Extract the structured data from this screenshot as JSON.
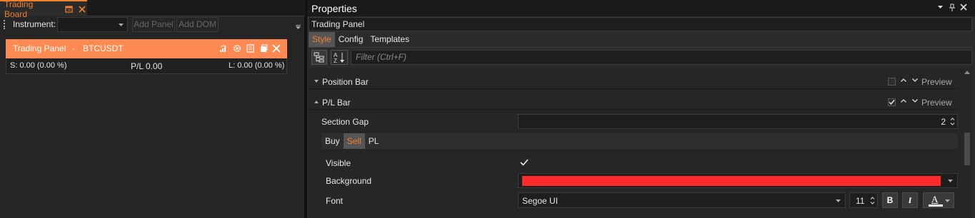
{
  "left_panel": {
    "tab_title": "Trading Board",
    "toolbar": {
      "instrument_label": "Instrument:",
      "instrument_value": "",
      "add_panel_label": "Add Panel",
      "add_dom_label": "Add DOM"
    },
    "trading_panel": {
      "title": "Trading Panel",
      "separator": "-",
      "symbol": "BTCUSDT",
      "short_label": "S:  0.00 (0.00 %)",
      "pl_label": "P/L  0.00",
      "long_label": "L:  0.00 (0.00 %)",
      "header_color": "#fd8a52"
    }
  },
  "properties": {
    "title": "Properties",
    "object_name": "Trading Panel",
    "tabs": [
      {
        "label": "Style",
        "active": true
      },
      {
        "label": "Config",
        "active": false
      },
      {
        "label": "Templates",
        "active": false
      }
    ],
    "filter_placeholder": "Filter (Ctrl+F)",
    "categories": [
      {
        "label": "Position Bar",
        "expanded": false,
        "checked": false,
        "preview_label": "Preview"
      },
      {
        "label": "P/L Bar",
        "expanded": true,
        "checked": true,
        "preview_label": "Preview"
      }
    ],
    "section_gap": {
      "label": "Section Gap",
      "value": "2"
    },
    "subtabs": [
      {
        "label": "Buy",
        "active": false
      },
      {
        "label": "Sell",
        "active": true
      },
      {
        "label": "PL",
        "active": false
      }
    ],
    "visible": {
      "label": "Visible",
      "checked": true
    },
    "background": {
      "label": "Background",
      "color": "#ff2a2a"
    },
    "font": {
      "label": "Font",
      "family": "Segoe UI",
      "size": "11",
      "bold_label": "B",
      "italic_label": "I",
      "color_label": "A",
      "color": "#ffffff"
    }
  },
  "colors": {
    "accent": "#f07f2e"
  }
}
